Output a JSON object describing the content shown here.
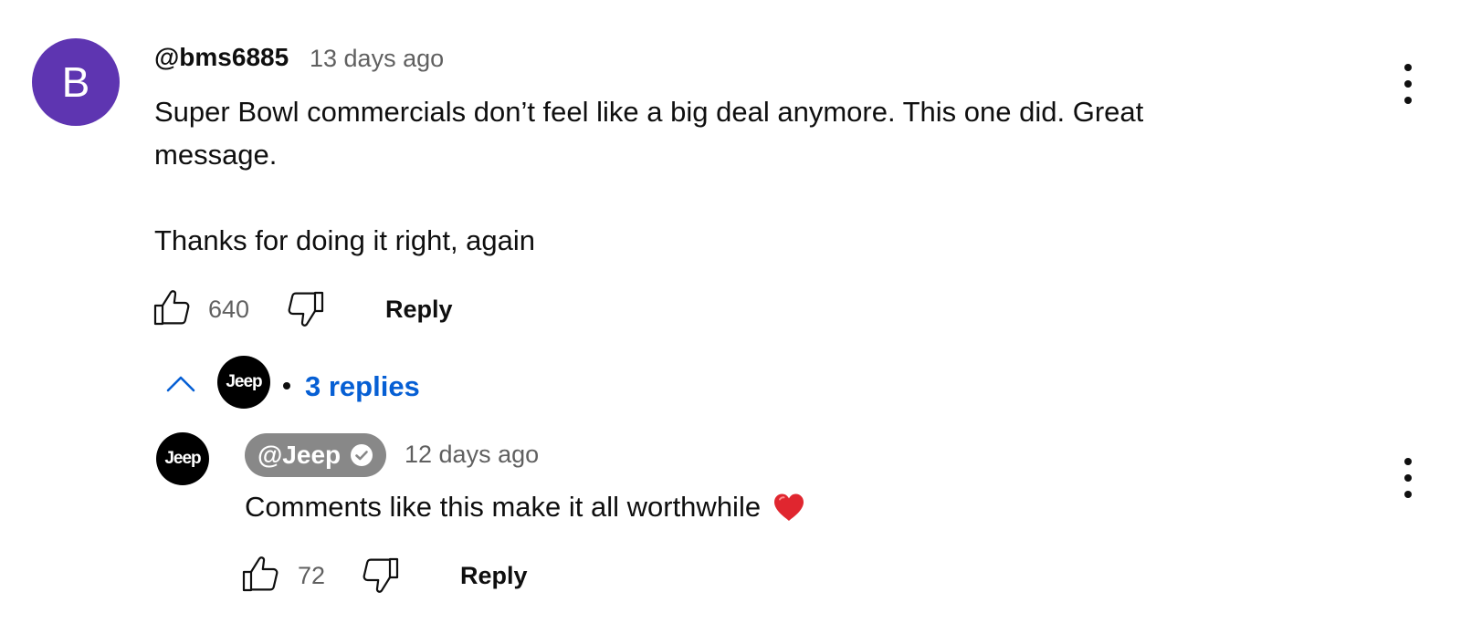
{
  "comment": {
    "avatar_letter": "B",
    "avatar_color": "#5e35b1",
    "author": "@bms6885",
    "timestamp": "13 days ago",
    "text": "Super Bowl commercials don’t feel like a big deal anymore. This one did. Great message.\n\nThanks for doing it right, again",
    "like_count": "640",
    "reply_label": "Reply",
    "menu_icon": "more-vert-icon"
  },
  "replies_toggle": {
    "icon": "chevron-up-icon",
    "avatar_text": "Jeep",
    "label": "3 replies",
    "link_color": "#065fd4"
  },
  "reply": {
    "avatar_text": "Jeep",
    "author": "@Jeep",
    "verified_icon": "verified-check-icon",
    "owner_badge_color": "#888888",
    "timestamp": "12 days ago",
    "text": "Comments like this make it all worthwhile",
    "emoji_icon": "red-heart-icon",
    "like_count": "72",
    "reply_label": "Reply",
    "menu_icon": "more-vert-icon"
  }
}
